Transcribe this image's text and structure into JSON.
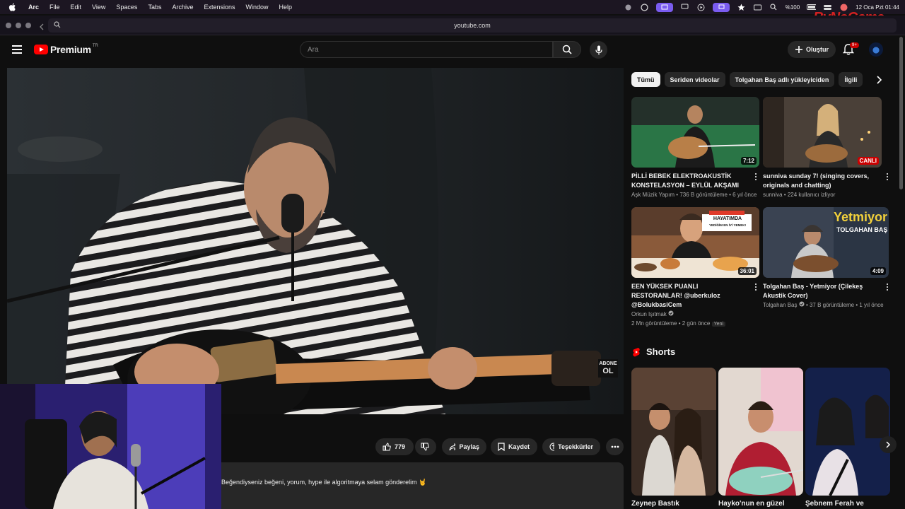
{
  "menubar": {
    "app": "Arc",
    "items": [
      "File",
      "Edit",
      "View",
      "Spaces",
      "Tabs",
      "Archive",
      "Extensions",
      "Window",
      "Help"
    ],
    "battery": "%100",
    "datetime": "12 Oca Pzt  01:44",
    "watermark": "ByNoGame"
  },
  "browser": {
    "url": "youtube.com"
  },
  "header": {
    "logo_text": "Premium",
    "country": "TR",
    "search_placeholder": "Ara",
    "create_label": "Oluştur",
    "notif_badge": "9+"
  },
  "video": {
    "overlay": {
      "line1": "ABONE",
      "line2": "OL"
    }
  },
  "actions": {
    "like_count": "779",
    "share": "Paylaş",
    "save": "Kaydet",
    "thanks": "Teşekkürler"
  },
  "description": "Beğendiyseniz beğeni, yorum, hype ile algoritmaya selam gönderelim 🤘",
  "chips": [
    "Tümü",
    "Seriden videolar",
    "Tolgahan Baş adlı yükleyiciden",
    "İlgili"
  ],
  "recommendations": [
    {
      "title": "PİLLİ BEBEK ELEKTROAKUSTİK KONSTELASYON – EYLÜL AKŞAMI",
      "channel": "Aşk Müzik Yapım",
      "meta": "736 B görüntüleme • 6 yıl önce",
      "duration": "7:12",
      "verified": false,
      "live": false
    },
    {
      "title": "sunniva sunday 7! (singing covers, originals and chatting)",
      "channel": "sunniva",
      "meta": "224 kullanıcı izliyor",
      "duration": "CANLI",
      "verified": false,
      "live": true
    },
    {
      "title": "EEN YÜKSEK PUANLI RESTORANLAR! @uberkuloz @BolukbasiCem",
      "channel": "Orkun Işıtmak",
      "meta": "2 Mn görüntüleme • 2 gün önce",
      "duration": "36:01",
      "verified": true,
      "live": false,
      "badge": "Yeni",
      "thumb_text": "HAYATIMDA",
      "thumb_sub": "YEDİĞİM EN İYİ YEMEK!"
    },
    {
      "title": "Tolgahan Baş - Yetmiyor (Çilekeş Akustik Cover)",
      "channel": "Tolgahan Baş",
      "meta": "37 B görüntüleme • 1 yıl önce",
      "duration": "4:09",
      "verified": true,
      "live": false,
      "thumb_text": "Yetmiyor",
      "thumb_sub": "TOLGAHAN BAŞ"
    }
  ],
  "shorts": {
    "heading": "Shorts",
    "items": [
      {
        "title": "Zeynep Bastık"
      },
      {
        "title": "Hayko'nun en güzel"
      },
      {
        "title": "Şebnem Ferah ve"
      }
    ]
  }
}
